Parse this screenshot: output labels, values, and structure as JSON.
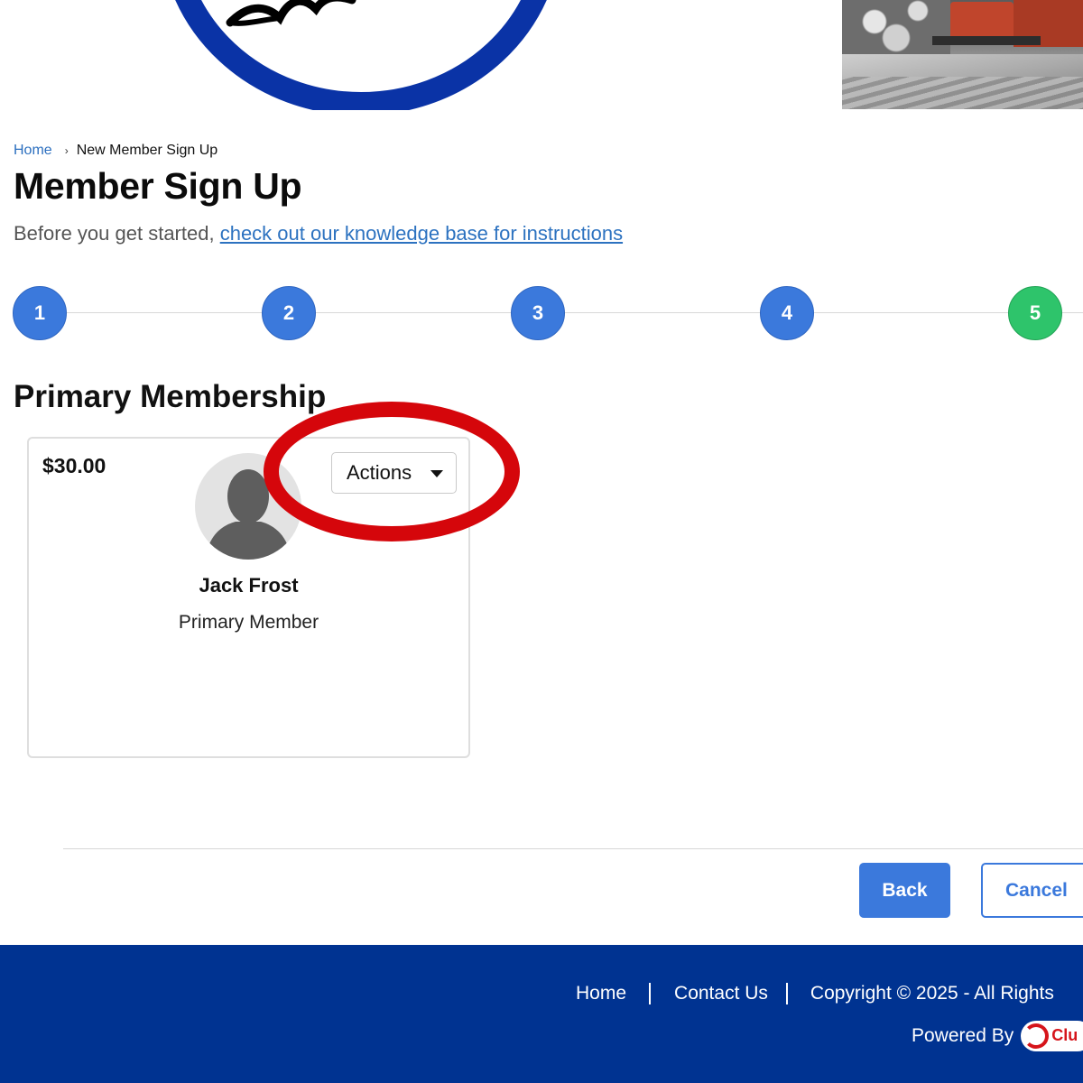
{
  "breadcrumb": {
    "home": "Home",
    "separator": "›",
    "current": "New Member Sign Up"
  },
  "page": {
    "title": "Member Sign Up",
    "intro_prefix": "Before you get started, ",
    "intro_link": "check out our knowledge base for instructions"
  },
  "steps": [
    {
      "label": "1",
      "state": "complete"
    },
    {
      "label": "2",
      "state": "complete"
    },
    {
      "label": "3",
      "state": "complete"
    },
    {
      "label": "4",
      "state": "complete"
    },
    {
      "label": "5",
      "state": "current"
    }
  ],
  "section": {
    "title": "Primary Membership"
  },
  "member_card": {
    "price": "$30.00",
    "actions_label": "Actions",
    "name": "Jack Frost",
    "role": "Primary Member",
    "avatar_icon": "person-silhouette-icon"
  },
  "buttons": {
    "back": "Back",
    "cancel": "Cancel"
  },
  "footer": {
    "home": "Home",
    "contact": "Contact Us",
    "copyright": "Copyright © 2025 - All Rights",
    "powered_by": "Powered By",
    "logo_text": "Clu"
  },
  "colors": {
    "primary": "#3b79dc",
    "step_current": "#2ec46b",
    "link": "#2c72c0",
    "footer_bg": "#003391",
    "highlight": "#d5060b"
  }
}
